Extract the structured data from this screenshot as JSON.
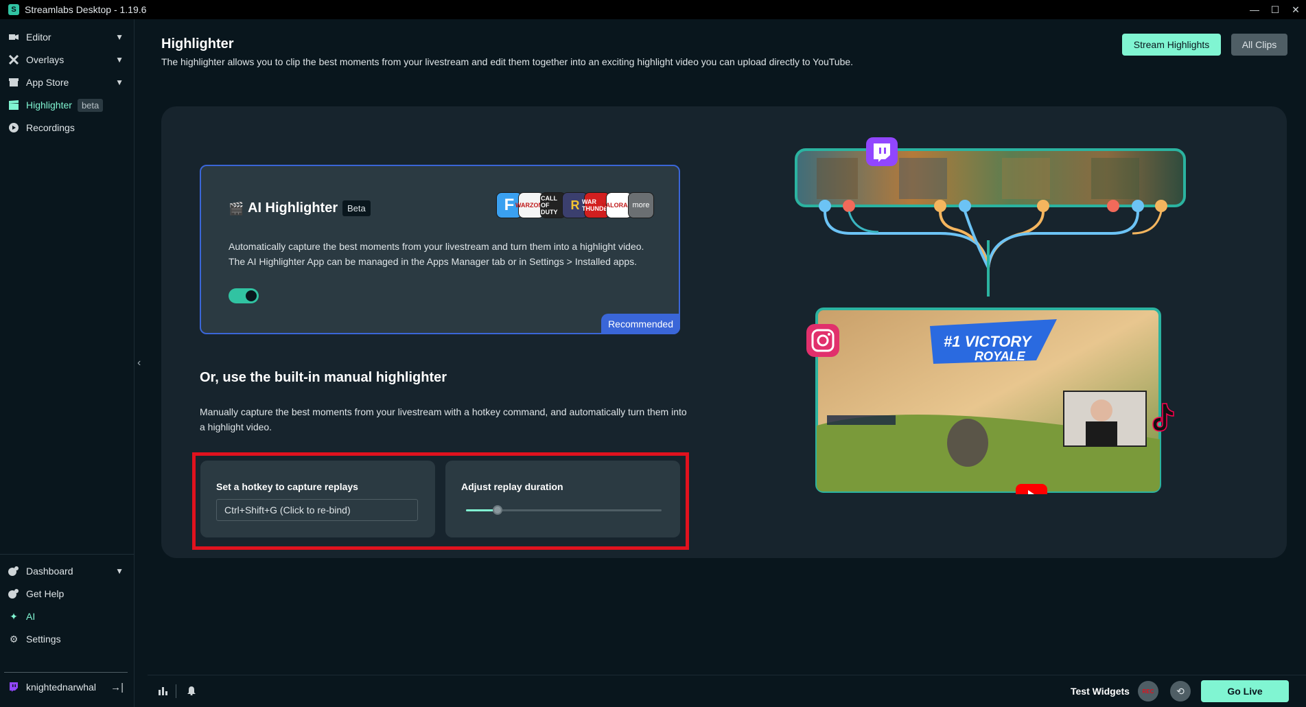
{
  "window": {
    "title": "Streamlabs Desktop - 1.19.6",
    "minimize": "—",
    "maximize": "☐",
    "close": "✕"
  },
  "sidebar": {
    "items": [
      {
        "label": "Editor",
        "icon": "editor-icon"
      },
      {
        "label": "Overlays",
        "icon": "overlays-icon"
      },
      {
        "label": "App Store",
        "icon": "app-store-icon"
      },
      {
        "label": "Highlighter",
        "icon": "highlighter-icon",
        "badge": "beta",
        "active": true
      },
      {
        "label": "Recordings",
        "icon": "recordings-icon"
      }
    ],
    "bottom_items": [
      {
        "label": "Dashboard",
        "icon": "dashboard-icon"
      },
      {
        "label": "Get Help",
        "icon": "help-icon"
      },
      {
        "label": "AI",
        "icon": "ai-sparkle-icon"
      },
      {
        "label": "Settings",
        "icon": "gear-icon"
      }
    ],
    "user": {
      "name": "knightednarwhal",
      "icon": "twitch-icon"
    }
  },
  "header": {
    "title": "Highlighter",
    "description": "The highlighter allows you to clip the best moments from your livestream and edit them together into an exciting highlight video you can upload directly to YouTube.",
    "stream_highlights_label": "Stream Highlights",
    "all_clips_label": "All Clips"
  },
  "ai_card": {
    "title": "AI Highlighter",
    "badge": "Beta",
    "description_1": "Automatically capture the best moments from your livestream and turn them into a highlight video.",
    "description_2": "The AI Highlighter App can be managed in the Apps Manager tab or in Settings > Installed apps.",
    "enabled": true,
    "recommended_label": "Recommended",
    "games": [
      {
        "label": "F",
        "color": "#3aa0f0"
      },
      {
        "label": "WARZONE",
        "color": "#f5f5f5"
      },
      {
        "label": "CALL OF DUTY",
        "color": "#222222"
      },
      {
        "label": "R",
        "color": "#3b3f6e"
      },
      {
        "label": "WAR THUNDER",
        "color": "#d21f1f"
      },
      {
        "label": "VALORANT",
        "color": "#ffffff"
      },
      {
        "label": "more",
        "color": "#6b6f72"
      }
    ]
  },
  "manual": {
    "title": "Or, use the built-in manual highlighter",
    "description": "Manually capture the best moments from your livestream with a hotkey command, and automatically turn them into a highlight video.",
    "hotkey_label": "Set a hotkey to capture replays",
    "hotkey_value": "Ctrl+Shift+G (Click to re-bind)",
    "duration_label": "Adjust replay duration",
    "duration_fraction": 0.16
  },
  "illustration": {
    "banner_text_1": "#1 VICTORY",
    "banner_text_2": "ROYALE"
  },
  "footer": {
    "test_widgets_label": "Test Widgets",
    "rec_label": "REC",
    "go_live_label": "Go Live"
  }
}
